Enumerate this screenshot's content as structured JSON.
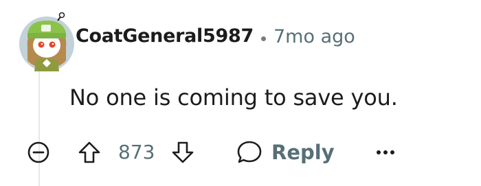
{
  "comment": {
    "author": "CoatGeneral5987",
    "separator": "•",
    "age": "7mo ago",
    "body": "No one is coming to save you."
  },
  "actions": {
    "score": "873",
    "reply_label": "Reply",
    "collapse_icon": "minus-circle-icon",
    "upvote_icon": "arrow-up-outline-icon",
    "downvote_icon": "arrow-down-outline-icon",
    "reply_icon": "speech-bubble-icon",
    "more_icon": "ellipsis-horizontal-icon"
  },
  "colors": {
    "text_primary": "#1c1c1c",
    "text_secondary": "#576f76",
    "thread_line": "#e5e7e9",
    "avatar_bg": "#b9c7cf",
    "hat_green": "#8bc34a"
  }
}
